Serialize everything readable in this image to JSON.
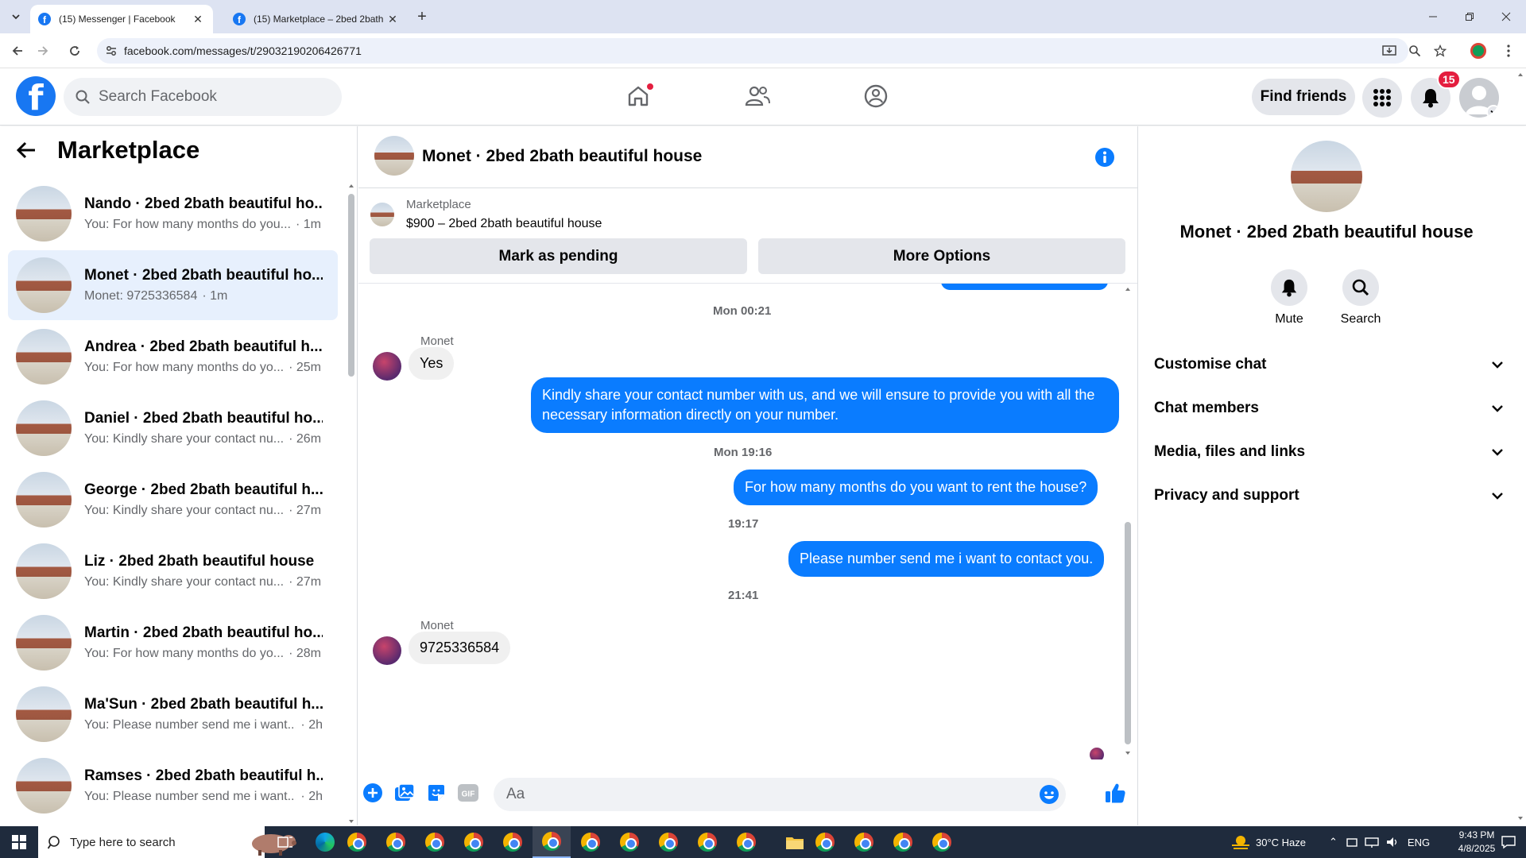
{
  "browser": {
    "tabs": [
      {
        "title": "(15) Messenger | Facebook",
        "active": true
      },
      {
        "title": "(15) Marketplace – 2bed 2bath",
        "active": false
      }
    ],
    "url": "facebook.com/messages/t/29032190206426771"
  },
  "fb_header": {
    "search_placeholder": "Search Facebook",
    "find_friends_label": "Find friends",
    "notification_count": "15"
  },
  "left_panel": {
    "title": "Marketplace",
    "conversations": [
      {
        "name": "Nando · 2bed 2bath beautiful ho...",
        "preview": "You: For how many months do you...",
        "time": "· 1m",
        "active": false
      },
      {
        "name": "Monet · 2bed 2bath beautiful ho...",
        "preview": "Monet: 9725336584",
        "time": "· 1m",
        "active": true
      },
      {
        "name": "Andrea · 2bed 2bath beautiful h...",
        "preview": "You: For how many months do yo...",
        "time": "· 25m",
        "active": false
      },
      {
        "name": "Daniel · 2bed 2bath beautiful ho...",
        "preview": "You: Kindly share your contact nu...",
        "time": "· 26m",
        "active": false
      },
      {
        "name": "George · 2bed 2bath beautiful h...",
        "preview": "You: Kindly share your contact nu...",
        "time": "· 27m",
        "active": false
      },
      {
        "name": "Liz · 2bed 2bath beautiful house",
        "preview": "You: Kindly share your contact nu...",
        "time": "· 27m",
        "active": false
      },
      {
        "name": "Martin · 2bed 2bath beautiful ho...",
        "preview": "You: For how many months do yo...",
        "time": "· 28m",
        "active": false
      },
      {
        "name": "Ma'Sun · 2bed 2bath beautiful h...",
        "preview": "You: Please number send me i want...",
        "time": "· 2h",
        "active": false
      },
      {
        "name": "Ramses · 2bed 2bath beautiful h...",
        "preview": "You: Please number send me i want...",
        "time": "· 2h",
        "active": false
      }
    ]
  },
  "chat": {
    "title": "Monet · 2bed 2bath beautiful house",
    "listing_label": "Marketplace",
    "listing_title": "$900 – 2bed 2bath beautiful house",
    "mark_pending_label": "Mark as pending",
    "more_options_label": "More Options",
    "timestamps": [
      "Mon 00:21",
      "Mon 19:16",
      "19:17",
      "21:41"
    ],
    "sender_name": "Monet",
    "messages": {
      "in_1": "Yes",
      "out_1": "Kindly share your contact number with us, and we will ensure to provide you with all the necessary information directly on your number.",
      "out_2": "For how many months do you want to rent the house?",
      "out_3": "Please number send me i want to contact you.",
      "in_2": "9725336584"
    },
    "composer_placeholder": "Aa"
  },
  "right_panel": {
    "name": "Monet · 2bed 2bath beautiful house",
    "mute_label": "Mute",
    "search_label": "Search",
    "sections": [
      "Customise chat",
      "Chat members",
      "Media, files and links",
      "Privacy and support"
    ]
  },
  "taskbar": {
    "search_placeholder": "Type here to search",
    "weather": "30°C  Haze",
    "language": "ENG",
    "time": "9:43 PM",
    "date": "4/8/2025"
  },
  "colors": {
    "fb_blue": "#1877f2",
    "messenger_blue": "#0a7cff",
    "active_row": "#e7f0fd",
    "notification_red": "#e41e3f"
  }
}
